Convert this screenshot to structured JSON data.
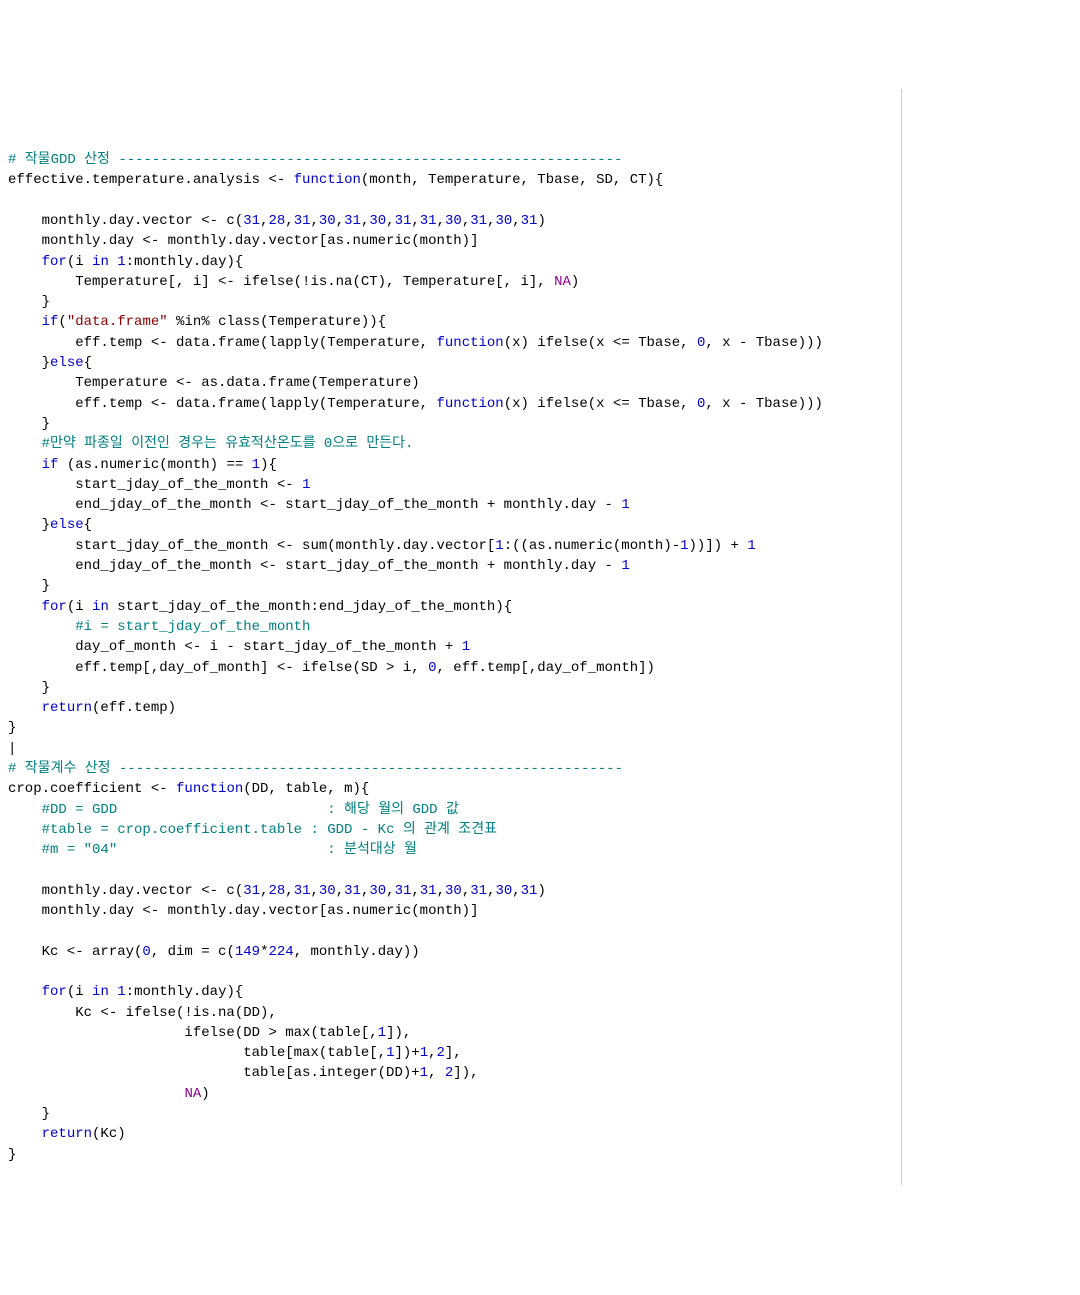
{
  "tokens": [
    [
      "c",
      "# 작물GDD 산정 ------------------------------------------------------------"
    ],
    [
      "p",
      "\n"
    ],
    [
      "p",
      "effective.temperature.analysis <- "
    ],
    [
      "k",
      "function"
    ],
    [
      "p",
      "(month, Temperature, Tbase, SD, CT){"
    ],
    [
      "p",
      "\n"
    ],
    [
      "p",
      "\n"
    ],
    [
      "p",
      "    monthly.day.vector <- c("
    ],
    [
      "n",
      "31"
    ],
    [
      "p",
      ","
    ],
    [
      "n",
      "28"
    ],
    [
      "p",
      ","
    ],
    [
      "n",
      "31"
    ],
    [
      "p",
      ","
    ],
    [
      "n",
      "30"
    ],
    [
      "p",
      ","
    ],
    [
      "n",
      "31"
    ],
    [
      "p",
      ","
    ],
    [
      "n",
      "30"
    ],
    [
      "p",
      ","
    ],
    [
      "n",
      "31"
    ],
    [
      "p",
      ","
    ],
    [
      "n",
      "31"
    ],
    [
      "p",
      ","
    ],
    [
      "n",
      "30"
    ],
    [
      "p",
      ","
    ],
    [
      "n",
      "31"
    ],
    [
      "p",
      ","
    ],
    [
      "n",
      "30"
    ],
    [
      "p",
      ","
    ],
    [
      "n",
      "31"
    ],
    [
      "p",
      ")"
    ],
    [
      "p",
      "\n"
    ],
    [
      "p",
      "    monthly.day <- monthly.day.vector[as.numeric(month)]"
    ],
    [
      "p",
      "\n"
    ],
    [
      "p",
      "    "
    ],
    [
      "k",
      "for"
    ],
    [
      "p",
      "(i "
    ],
    [
      "k",
      "in"
    ],
    [
      "p",
      " "
    ],
    [
      "n",
      "1"
    ],
    [
      "p",
      ":monthly.day){"
    ],
    [
      "p",
      "\n"
    ],
    [
      "p",
      "        Temperature[, i] <- ifelse(!is.na(CT), Temperature[, i], "
    ],
    [
      "cn",
      "NA"
    ],
    [
      "p",
      ")"
    ],
    [
      "p",
      "\n"
    ],
    [
      "p",
      "    }"
    ],
    [
      "p",
      "\n"
    ],
    [
      "p",
      "    "
    ],
    [
      "k",
      "if"
    ],
    [
      "p",
      "("
    ],
    [
      "s",
      "\"data.frame\""
    ],
    [
      "p",
      " %in% class(Temperature)){"
    ],
    [
      "p",
      "\n"
    ],
    [
      "p",
      "        eff.temp <- data.frame(lapply(Temperature, "
    ],
    [
      "k",
      "function"
    ],
    [
      "p",
      "(x) ifelse(x <= Tbase, "
    ],
    [
      "n",
      "0"
    ],
    [
      "p",
      ", x - Tbase)))"
    ],
    [
      "p",
      "\n"
    ],
    [
      "p",
      "    }"
    ],
    [
      "k",
      "else"
    ],
    [
      "p",
      "{"
    ],
    [
      "p",
      "\n"
    ],
    [
      "p",
      "        Temperature <- as.data.frame(Temperature)"
    ],
    [
      "p",
      "\n"
    ],
    [
      "p",
      "        eff.temp <- data.frame(lapply(Temperature, "
    ],
    [
      "k",
      "function"
    ],
    [
      "p",
      "(x) ifelse(x <= Tbase, "
    ],
    [
      "n",
      "0"
    ],
    [
      "p",
      ", x - Tbase)))"
    ],
    [
      "p",
      "\n"
    ],
    [
      "p",
      "    }"
    ],
    [
      "p",
      "\n"
    ],
    [
      "p",
      "    "
    ],
    [
      "c",
      "#만약 파종일 이전인 경우는 유효적산온도를 0으로 만든다."
    ],
    [
      "p",
      "\n"
    ],
    [
      "p",
      "    "
    ],
    [
      "k",
      "if"
    ],
    [
      "p",
      " (as.numeric(month) == "
    ],
    [
      "n",
      "1"
    ],
    [
      "p",
      "){"
    ],
    [
      "p",
      "\n"
    ],
    [
      "p",
      "        start_jday_of_the_month <- "
    ],
    [
      "n",
      "1"
    ],
    [
      "p",
      "\n"
    ],
    [
      "p",
      "        end_jday_of_the_month <- start_jday_of_the_month + monthly.day - "
    ],
    [
      "n",
      "1"
    ],
    [
      "p",
      "\n"
    ],
    [
      "p",
      "    }"
    ],
    [
      "k",
      "else"
    ],
    [
      "p",
      "{"
    ],
    [
      "p",
      "\n"
    ],
    [
      "p",
      "        start_jday_of_the_month <- sum(monthly.day.vector["
    ],
    [
      "n",
      "1"
    ],
    [
      "p",
      ":((as.numeric(month)-"
    ],
    [
      "n",
      "1"
    ],
    [
      "p",
      "))]) + "
    ],
    [
      "n",
      "1"
    ],
    [
      "p",
      "\n"
    ],
    [
      "p",
      "        end_jday_of_the_month <- start_jday_of_the_month + monthly.day - "
    ],
    [
      "n",
      "1"
    ],
    [
      "p",
      "\n"
    ],
    [
      "p",
      "    }"
    ],
    [
      "p",
      "\n"
    ],
    [
      "p",
      "    "
    ],
    [
      "k",
      "for"
    ],
    [
      "p",
      "(i "
    ],
    [
      "k",
      "in"
    ],
    [
      "p",
      " start_jday_of_the_month:end_jday_of_the_month){"
    ],
    [
      "p",
      "\n"
    ],
    [
      "p",
      "        "
    ],
    [
      "c",
      "#i = start_jday_of_the_month"
    ],
    [
      "p",
      "\n"
    ],
    [
      "p",
      "        day_of_month <- i - start_jday_of_the_month + "
    ],
    [
      "n",
      "1"
    ],
    [
      "p",
      "\n"
    ],
    [
      "p",
      "        eff.temp[,day_of_month] <- ifelse(SD > i, "
    ],
    [
      "n",
      "0"
    ],
    [
      "p",
      ", eff.temp[,day_of_month])"
    ],
    [
      "p",
      "\n"
    ],
    [
      "p",
      "    }"
    ],
    [
      "p",
      "\n"
    ],
    [
      "p",
      "    "
    ],
    [
      "k",
      "return"
    ],
    [
      "p",
      "(eff.temp)"
    ],
    [
      "p",
      "\n"
    ],
    [
      "p",
      "}"
    ],
    [
      "p",
      "\n"
    ],
    [
      "p",
      "|"
    ],
    [
      "p",
      "\n"
    ],
    [
      "c",
      "# 작물계수 산정 ------------------------------------------------------------"
    ],
    [
      "p",
      "\n"
    ],
    [
      "p",
      "crop.coefficient <- "
    ],
    [
      "k",
      "function"
    ],
    [
      "p",
      "(DD, table, m){"
    ],
    [
      "p",
      "\n"
    ],
    [
      "p",
      "    "
    ],
    [
      "c",
      "#DD = GDD                         : 해당 월의 GDD 값"
    ],
    [
      "p",
      "\n"
    ],
    [
      "p",
      "    "
    ],
    [
      "c",
      "#table = crop.coefficient.table : GDD - Kc 의 관계 조견표"
    ],
    [
      "p",
      "\n"
    ],
    [
      "p",
      "    "
    ],
    [
      "c",
      "#m = \"04\"                         : 분석대상 월"
    ],
    [
      "p",
      "\n"
    ],
    [
      "p",
      "\n"
    ],
    [
      "p",
      "    monthly.day.vector <- c("
    ],
    [
      "n",
      "31"
    ],
    [
      "p",
      ","
    ],
    [
      "n",
      "28"
    ],
    [
      "p",
      ","
    ],
    [
      "n",
      "31"
    ],
    [
      "p",
      ","
    ],
    [
      "n",
      "30"
    ],
    [
      "p",
      ","
    ],
    [
      "n",
      "31"
    ],
    [
      "p",
      ","
    ],
    [
      "n",
      "30"
    ],
    [
      "p",
      ","
    ],
    [
      "n",
      "31"
    ],
    [
      "p",
      ","
    ],
    [
      "n",
      "31"
    ],
    [
      "p",
      ","
    ],
    [
      "n",
      "30"
    ],
    [
      "p",
      ","
    ],
    [
      "n",
      "31"
    ],
    [
      "p",
      ","
    ],
    [
      "n",
      "30"
    ],
    [
      "p",
      ","
    ],
    [
      "n",
      "31"
    ],
    [
      "p",
      ")"
    ],
    [
      "p",
      "\n"
    ],
    [
      "p",
      "    monthly.day <- monthly.day.vector[as.numeric(month)]"
    ],
    [
      "p",
      "\n"
    ],
    [
      "p",
      "\n"
    ],
    [
      "p",
      "    Kc <- array("
    ],
    [
      "n",
      "0"
    ],
    [
      "p",
      ", dim = c("
    ],
    [
      "n",
      "149"
    ],
    [
      "p",
      "*"
    ],
    [
      "n",
      "224"
    ],
    [
      "p",
      ", monthly.day))"
    ],
    [
      "p",
      "\n"
    ],
    [
      "p",
      "\n"
    ],
    [
      "p",
      "    "
    ],
    [
      "k",
      "for"
    ],
    [
      "p",
      "(i "
    ],
    [
      "k",
      "in"
    ],
    [
      "p",
      " "
    ],
    [
      "n",
      "1"
    ],
    [
      "p",
      ":monthly.day){"
    ],
    [
      "p",
      "\n"
    ],
    [
      "p",
      "        Kc <- ifelse(!is.na(DD),"
    ],
    [
      "p",
      "\n"
    ],
    [
      "p",
      "                     ifelse(DD > max(table[,"
    ],
    [
      "n",
      "1"
    ],
    [
      "p",
      "]),"
    ],
    [
      "p",
      "\n"
    ],
    [
      "p",
      "                            table[max(table[,"
    ],
    [
      "n",
      "1"
    ],
    [
      "p",
      "])+"
    ],
    [
      "n",
      "1"
    ],
    [
      "p",
      ","
    ],
    [
      "n",
      "2"
    ],
    [
      "p",
      "],"
    ],
    [
      "p",
      "\n"
    ],
    [
      "p",
      "                            table[as.integer(DD)+"
    ],
    [
      "n",
      "1"
    ],
    [
      "p",
      ", "
    ],
    [
      "n",
      "2"
    ],
    [
      "p",
      "]),"
    ],
    [
      "p",
      "\n"
    ],
    [
      "p",
      "                     "
    ],
    [
      "cn",
      "NA"
    ],
    [
      "p",
      ")"
    ],
    [
      "p",
      "\n"
    ],
    [
      "p",
      "    }"
    ],
    [
      "p",
      "\n"
    ],
    [
      "p",
      "    "
    ],
    [
      "k",
      "return"
    ],
    [
      "p",
      "(Kc)"
    ],
    [
      "p",
      "\n"
    ],
    [
      "p",
      "}"
    ],
    [
      "p",
      "\n"
    ]
  ]
}
